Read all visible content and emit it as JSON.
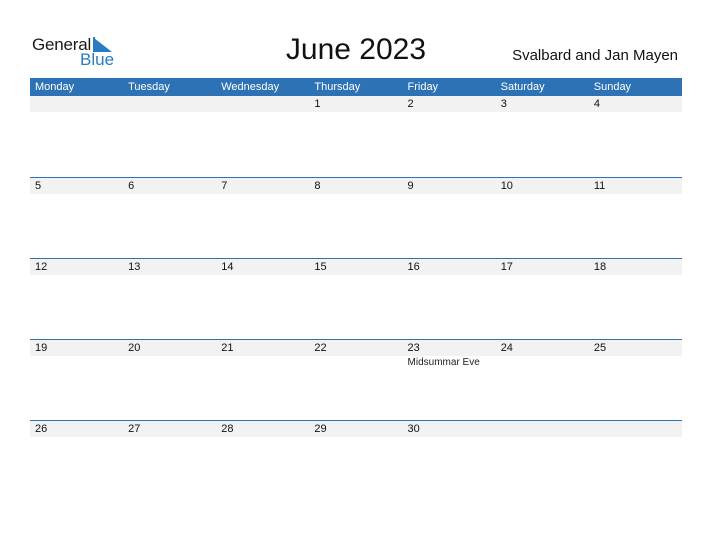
{
  "logo": {
    "general": "General",
    "blue": "Blue"
  },
  "title": "June 2023",
  "region": "Svalbard and Jan Mayen",
  "colors": {
    "accent": "#2e72b6",
    "band": "#f2f2f2"
  },
  "weekdays": [
    "Monday",
    "Tuesday",
    "Wednesday",
    "Thursday",
    "Friday",
    "Saturday",
    "Sunday"
  ],
  "weeks": [
    [
      {
        "d": ""
      },
      {
        "d": ""
      },
      {
        "d": ""
      },
      {
        "d": "1"
      },
      {
        "d": "2"
      },
      {
        "d": "3"
      },
      {
        "d": "4"
      }
    ],
    [
      {
        "d": "5"
      },
      {
        "d": "6"
      },
      {
        "d": "7"
      },
      {
        "d": "8"
      },
      {
        "d": "9"
      },
      {
        "d": "10"
      },
      {
        "d": "11"
      }
    ],
    [
      {
        "d": "12"
      },
      {
        "d": "13"
      },
      {
        "d": "14"
      },
      {
        "d": "15"
      },
      {
        "d": "16"
      },
      {
        "d": "17"
      },
      {
        "d": "18"
      }
    ],
    [
      {
        "d": "19"
      },
      {
        "d": "20"
      },
      {
        "d": "21"
      },
      {
        "d": "22"
      },
      {
        "d": "23",
        "e": "Midsummar Eve"
      },
      {
        "d": "24"
      },
      {
        "d": "25"
      }
    ],
    [
      {
        "d": "26"
      },
      {
        "d": "27"
      },
      {
        "d": "28"
      },
      {
        "d": "29"
      },
      {
        "d": "30"
      },
      {
        "d": ""
      },
      {
        "d": ""
      }
    ]
  ]
}
